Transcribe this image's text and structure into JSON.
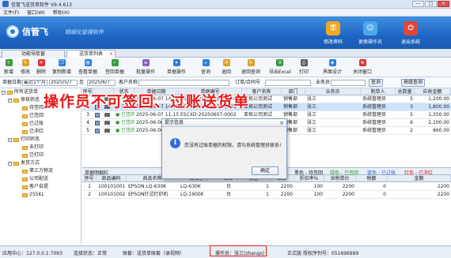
{
  "window": {
    "title": "信管飞送货单软件 V9.4.613",
    "buttons": [
      "—",
      "□",
      "×"
    ]
  },
  "menu": [
    "文件(F)",
    "窗口(W)",
    "帮助(H)"
  ],
  "banner": {
    "brand": "信管飞",
    "slogan": "精细化管理软件",
    "buttons": [
      {
        "label": "修改密码",
        "icon": "key-icon",
        "color": "#f5a623"
      },
      {
        "label": "更换操作员",
        "icon": "users-icon",
        "color": "#4ea8e8"
      },
      {
        "label": "退出系统",
        "icon": "power-icon",
        "color": "#e0463b"
      }
    ]
  },
  "tabs": [
    {
      "label": "功能导航窗"
    },
    {
      "label": "送货单列表",
      "close": "×"
    }
  ],
  "toolbar": [
    {
      "label": "新增",
      "icon": "add-icon",
      "color": "#3a9a3a"
    },
    {
      "label": "修改",
      "icon": "edit-icon",
      "color": "#e0a020"
    },
    {
      "label": "删除",
      "icon": "delete-icon",
      "color": "#d33"
    },
    {
      "label": "复制新增",
      "icon": "copy-icon",
      "color": "#2a7ee0"
    },
    {
      "label": "查看单据",
      "icon": "view-icon",
      "color": "#2a7ee0"
    },
    {
      "label": "签回单据",
      "icon": "sign-back-icon",
      "color": "#3a9a3a"
    },
    {
      "label": "批量操作",
      "icon": "batch-icon",
      "color": "#8a5cc8"
    },
    {
      "label": "单据操作",
      "icon": "doc-op-icon",
      "color": "#2a7ee0"
    },
    {
      "label": "查询",
      "icon": "search-icon",
      "color": "#2a7ee0"
    },
    {
      "label": "退回",
      "icon": "return-icon",
      "color": "#e0a020"
    },
    {
      "label": "退回查询",
      "icon": "return-search-icon",
      "color": "#e0a020"
    },
    {
      "label": "导出Excel",
      "icon": "excel-icon",
      "color": "#3a9a3a"
    },
    {
      "label": "打印",
      "icon": "print-icon",
      "color": "#555"
    },
    {
      "label": "界面设计",
      "icon": "design-icon",
      "color": "#2a7ee0"
    },
    {
      "label": "关闭窗口",
      "icon": "close-window-icon",
      "color": "#d33"
    }
  ],
  "filter": {
    "date_label": "单据日期",
    "range": "最近1个月",
    "date_from": "2025/5/7",
    "to": "至",
    "date_to": "2025/6/7",
    "customer_label": "客户名称",
    "order_label": "订单/合同号",
    "staff_label": "业务员",
    "query": "查询",
    "adv_query": "高级查询"
  },
  "tree": [
    {
      "label": "所有送货单",
      "level": 0,
      "folder": true,
      "expand": "-"
    },
    {
      "label": "审核状态",
      "level": 1,
      "folder": true,
      "expand": "-"
    },
    {
      "label": "待签回",
      "level": 2,
      "folder": true
    },
    {
      "label": "已签回",
      "level": 2,
      "folder": true
    },
    {
      "label": "已过账",
      "level": 2,
      "folder": true
    },
    {
      "label": "已冲红",
      "level": 2,
      "folder": true
    },
    {
      "label": "打印状态",
      "level": 1,
      "folder": true,
      "expand": "-"
    },
    {
      "label": "未打印",
      "level": 2,
      "folder": true
    },
    {
      "label": "已打印",
      "level": 2,
      "folder": true
    },
    {
      "label": "发货方式",
      "level": 1,
      "folder": true,
      "expand": "-"
    },
    {
      "label": "第三方物流",
      "level": 2,
      "folder": true
    },
    {
      "label": "公司配送",
      "level": 2,
      "folder": true
    },
    {
      "label": "客户自提",
      "level": 2,
      "folder": true
    },
    {
      "label": "255KL",
      "level": 2,
      "folder": true
    }
  ],
  "grid": {
    "columns": [
      "序号",
      "",
      "状态",
      "单据日期",
      "单据编号",
      "客户名称",
      "部门",
      "业务员",
      "制单人",
      "总数量",
      "应收金额"
    ],
    "rows": [
      {
        "no": "1",
        "state": "已签回",
        "state_color": "#3a9a3a",
        "date": "2025-06-07 14:28",
        "code": "ESCXD-20250607-0004",
        "cust": "亚拓公司测试",
        "dept": "销售部",
        "staff": "张三",
        "maker": "系统管理员",
        "qty": "5",
        "amt": "1,200.00",
        "sel": false
      },
      {
        "no": "2",
        "state": "已过账",
        "state_color": "#2a7ee0",
        "date": "2025-06-07 14:08",
        "code": "ESCXD-20250607-0003",
        "cust": "亚拓公司测试",
        "dept": "销售部",
        "staff": "张三",
        "maker": "系统管理员",
        "qty": "3",
        "amt": "1,800.00",
        "sel": true
      },
      {
        "no": "3",
        "state": "已签回",
        "state_color": "#3a9a3a",
        "date": "2025-06-07 11:15",
        "code": "ESCXD-20250607-0002",
        "cust": "亚拓公司测试",
        "dept": "销售部",
        "staff": "张三",
        "maker": "系统管理员",
        "qty": "5",
        "amt": "1,350.00",
        "sel": false
      },
      {
        "no": "4",
        "state": "已签回",
        "state_color": "#3a9a3a",
        "date": "2025-06-06 16:40",
        "code": "ESCXD-20250606-0005",
        "cust": "亚拓公司测试",
        "dept": "销售部",
        "staff": "张三",
        "maker": "系统管理员",
        "qty": "6",
        "amt": "2,100.00",
        "sel": false
      },
      {
        "no": "5",
        "state": "已签回",
        "state_color": "#3a9a3a",
        "date": "2025-06-06 10:02",
        "code": "ESCXD-20250606-0004",
        "cust": "亚拓公司测试",
        "dept": "销售部",
        "staff": "张三",
        "maker": "系统管理员",
        "qty": "2",
        "amt": "860.00",
        "sel": false
      }
    ]
  },
  "detail": {
    "title": "单据明细栏",
    "legend": [
      {
        "text": "黑色 - 待签回",
        "color": "#222"
      },
      {
        "text": "绿色 - 已签回",
        "color": "#2a9a2a"
      },
      {
        "text": "蓝色 - 已过账",
        "color": "#2a5fd0"
      },
      {
        "text": "红色 - 已冲红",
        "color": "#d22"
      }
    ],
    "columns": [
      "序号",
      "商品编码",
      "商品名称",
      "规格型号",
      "单位",
      "数量",
      "单价",
      "折扣率%",
      "含税单价",
      "税额",
      "金额"
    ],
    "rows": [
      {
        "no": "1",
        "code": "100101001",
        "name": "EPSON LQ-630K",
        "spec": "LQ-630K",
        "unit": "台",
        "qty": "1",
        "price": "2200",
        "disc": "100",
        "tprice": "2200",
        "tax": "0",
        "amt": "2200"
      },
      {
        "no": "2",
        "code": "100101002",
        "name": "EPSON针式打印机",
        "spec": "LQ-1600K",
        "unit": "台",
        "qty": "1",
        "price": "2200",
        "disc": "100",
        "tprice": "2200",
        "tax": "0",
        "amt": "2200"
      }
    ]
  },
  "dialog": {
    "title": "提示信息",
    "message": "您没有过账单据的权限，请与系统管理员联系!",
    "ok": "确定",
    "close": "×"
  },
  "overlay": {
    "text": "操作员不可签回、过账送货单"
  },
  "status": {
    "server": "应用中心：127.0.0.1:7093",
    "conn": "连接状态：正常",
    "account": "账套：送货单账套（录视频）",
    "operator": "操作员：张三(zhangs)",
    "license": "正式版  授权序列号：051696989"
  }
}
